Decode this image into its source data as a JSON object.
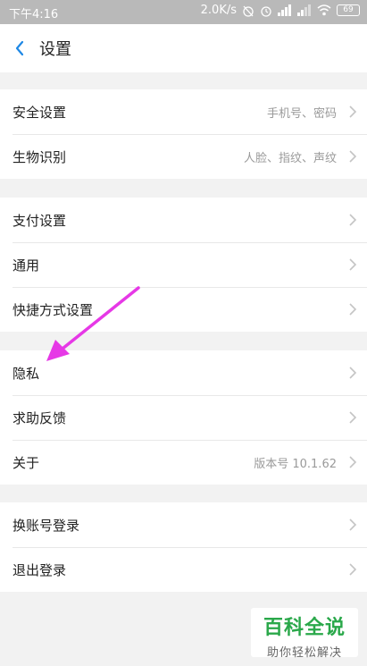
{
  "status_bar": {
    "time": "下午4:16",
    "speed": "2.0K/s",
    "battery": "69",
    "icons": [
      "alarm-off-icon",
      "alarm-icon",
      "signal-icon",
      "signal-icon",
      "wifi-icon",
      "battery-icon"
    ]
  },
  "header": {
    "title": "设置"
  },
  "groups": [
    {
      "items": [
        {
          "label": "安全设置",
          "value": "手机号、密码"
        },
        {
          "label": "生物识别",
          "value": "人脸、指纹、声纹"
        }
      ]
    },
    {
      "items": [
        {
          "label": "支付设置",
          "value": ""
        },
        {
          "label": "通用",
          "value": ""
        },
        {
          "label": "快捷方式设置",
          "value": ""
        }
      ]
    },
    {
      "items": [
        {
          "label": "隐私",
          "value": ""
        },
        {
          "label": "求助反馈",
          "value": ""
        },
        {
          "label": "关于",
          "value": "版本号 10.1.62"
        }
      ]
    },
    {
      "items": [
        {
          "label": "换账号登录",
          "value": ""
        },
        {
          "label": "退出登录",
          "value": ""
        }
      ]
    }
  ],
  "watermark": {
    "title": "百科全说",
    "subtitle": "助你轻松解决"
  },
  "colors": {
    "accent": "#1e88e5",
    "annotation_arrow": "#e638e6",
    "status_bar": "#b9b9b9"
  }
}
